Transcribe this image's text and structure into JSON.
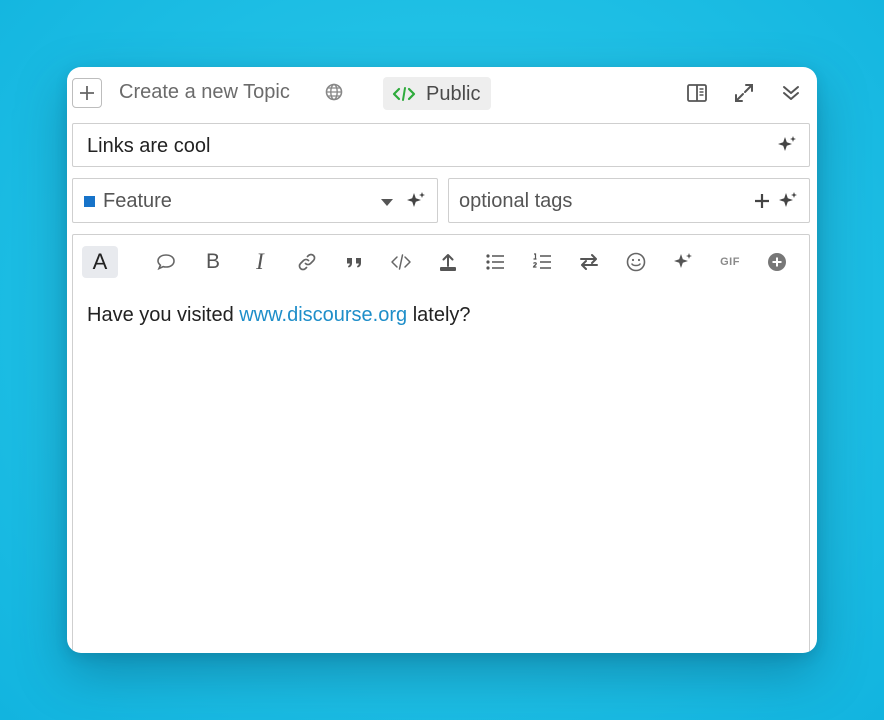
{
  "header": {
    "title": "Create a new Topic",
    "visibility_label": "Public",
    "new_icon": "plus-icon",
    "globe_icon": "globe-icon",
    "visibility_icon": "public-code-icon",
    "icons": [
      "toggle-preview-icon",
      "fullscreen-icon",
      "collapse-icon"
    ]
  },
  "topic_title": {
    "value": "Links are cool",
    "icon": "sparkle-icon"
  },
  "category": {
    "selected": "Feature",
    "color": "#1773c9"
  },
  "tags": {
    "placeholder": "optional tags"
  },
  "toolbar": {
    "items": [
      "text-style",
      "speech-bubble",
      "bold",
      "italic",
      "link",
      "quote",
      "code",
      "upload",
      "bullet-list",
      "numbered-list",
      "toggle-direction",
      "emoji",
      "ai-sparkle",
      "gif",
      "more-options"
    ],
    "text_style_glyph": "A",
    "bold_glyph": "B",
    "italic_glyph": "I",
    "gif_label": "GIF"
  },
  "editor": {
    "text_before": "Have you visited ",
    "link_text": "www.discourse.org",
    "text_after": " lately?"
  },
  "colors": {
    "accent_link": "#1e8ec9",
    "public_icon": "#2eab3c",
    "background": "#22c2e6"
  }
}
